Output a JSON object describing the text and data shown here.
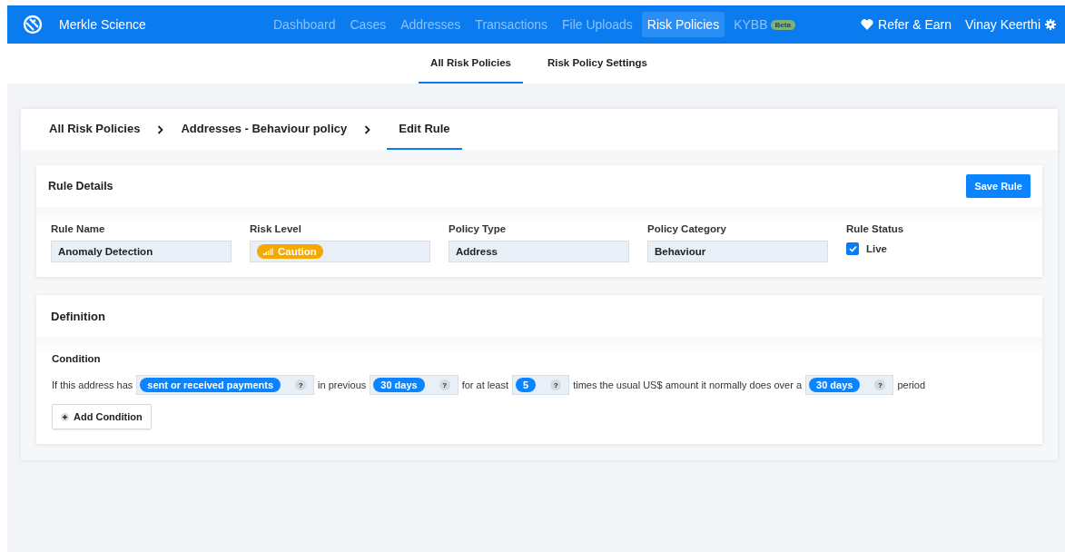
{
  "header": {
    "brand": "Merkle Science",
    "nav": [
      {
        "label": "Dashboard",
        "selected": false
      },
      {
        "label": "Cases",
        "selected": false
      },
      {
        "label": "Addresses",
        "selected": false
      },
      {
        "label": "Transactions",
        "selected": false
      },
      {
        "label": "File Uploads",
        "selected": false
      },
      {
        "label": "Risk Policies",
        "selected": true
      },
      {
        "label": "KYBB",
        "selected": false,
        "badge": "Beta"
      }
    ],
    "refer": "Refer & Earn",
    "user": "Vinay Keerthi"
  },
  "subtabs": [
    {
      "label": "All Risk Policies",
      "selected": true
    },
    {
      "label": "Risk Policy Settings",
      "selected": false
    }
  ],
  "breadcrumb": [
    {
      "label": "All Risk Policies",
      "selected": false
    },
    {
      "label": "Addresses - Behaviour policy",
      "selected": false
    },
    {
      "label": "Edit Rule",
      "selected": true
    }
  ],
  "rule_details": {
    "title": "Rule Details",
    "save_button": "Save Rule",
    "fields": [
      {
        "kind": "text",
        "label": "Rule Name",
        "value": "Anomaly Detection"
      },
      {
        "kind": "risk",
        "label": "Risk Level",
        "value": "Caution",
        "color": "#f5a800"
      },
      {
        "kind": "text",
        "label": "Policy Type",
        "value": "Address"
      },
      {
        "kind": "text",
        "label": "Policy Category",
        "value": "Behaviour"
      },
      {
        "kind": "checkbox",
        "label": "Rule Status",
        "value": "Live",
        "checked": true
      }
    ]
  },
  "definition": {
    "title": "Definition",
    "condition_label": "Condition",
    "condition": [
      {
        "kind": "text",
        "text": "If this address has"
      },
      {
        "kind": "chip",
        "value": "sent or received payments",
        "help": "?"
      },
      {
        "kind": "text",
        "text": "in previous"
      },
      {
        "kind": "chip",
        "value": "30 days",
        "help": "?"
      },
      {
        "kind": "text",
        "text": "for at least"
      },
      {
        "kind": "chip",
        "value": "5",
        "help": "?"
      },
      {
        "kind": "text",
        "text": "times the usual US$ amount it normally does over a"
      },
      {
        "kind": "chip",
        "value": "30 days",
        "help": "?"
      },
      {
        "kind": "text",
        "text": "period"
      }
    ],
    "add_button": "Add Condition"
  }
}
